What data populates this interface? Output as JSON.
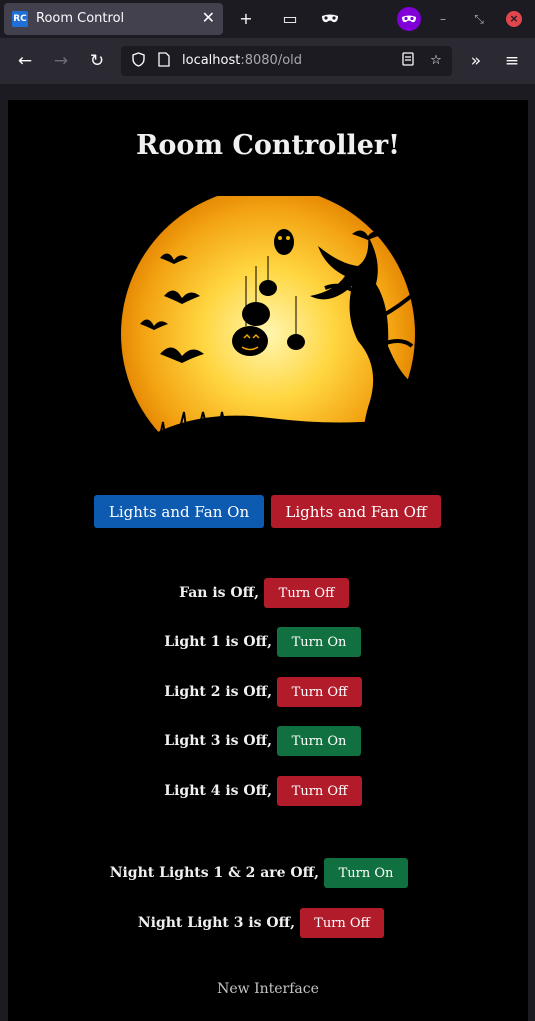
{
  "browser": {
    "tab_title": "Room Control",
    "favicon_text": "RC",
    "url_host": "localhost",
    "url_rest": ":8080/old"
  },
  "page": {
    "title": "Room Controller!",
    "master_on_label": "Lights and Fan On",
    "master_off_label": "Lights and Fan Off",
    "devices": [
      {
        "status": "Fan is Off,",
        "button": "Turn Off",
        "button_color": "#b11b2a"
      },
      {
        "status": "Light 1 is Off,",
        "button": "Turn On",
        "button_color": "#11703f"
      },
      {
        "status": "Light 2 is Off,",
        "button": "Turn Off",
        "button_color": "#b11b2a"
      },
      {
        "status": "Light 3 is Off,",
        "button": "Turn On",
        "button_color": "#11703f"
      },
      {
        "status": "Light 4 is Off,",
        "button": "Turn Off",
        "button_color": "#b11b2a"
      }
    ],
    "night_devices": [
      {
        "status": "Night Lights 1 & 2 are Off,",
        "button": "Turn On",
        "button_color": "#11703f"
      },
      {
        "status": "Night Light 3 is Off,",
        "button": "Turn Off",
        "button_color": "#b11b2a"
      }
    ],
    "footer_link": "New Interface"
  },
  "colors": {
    "accent_blue": "#0d5ab1",
    "off_red": "#b11b2a",
    "on_green": "#11703f"
  }
}
